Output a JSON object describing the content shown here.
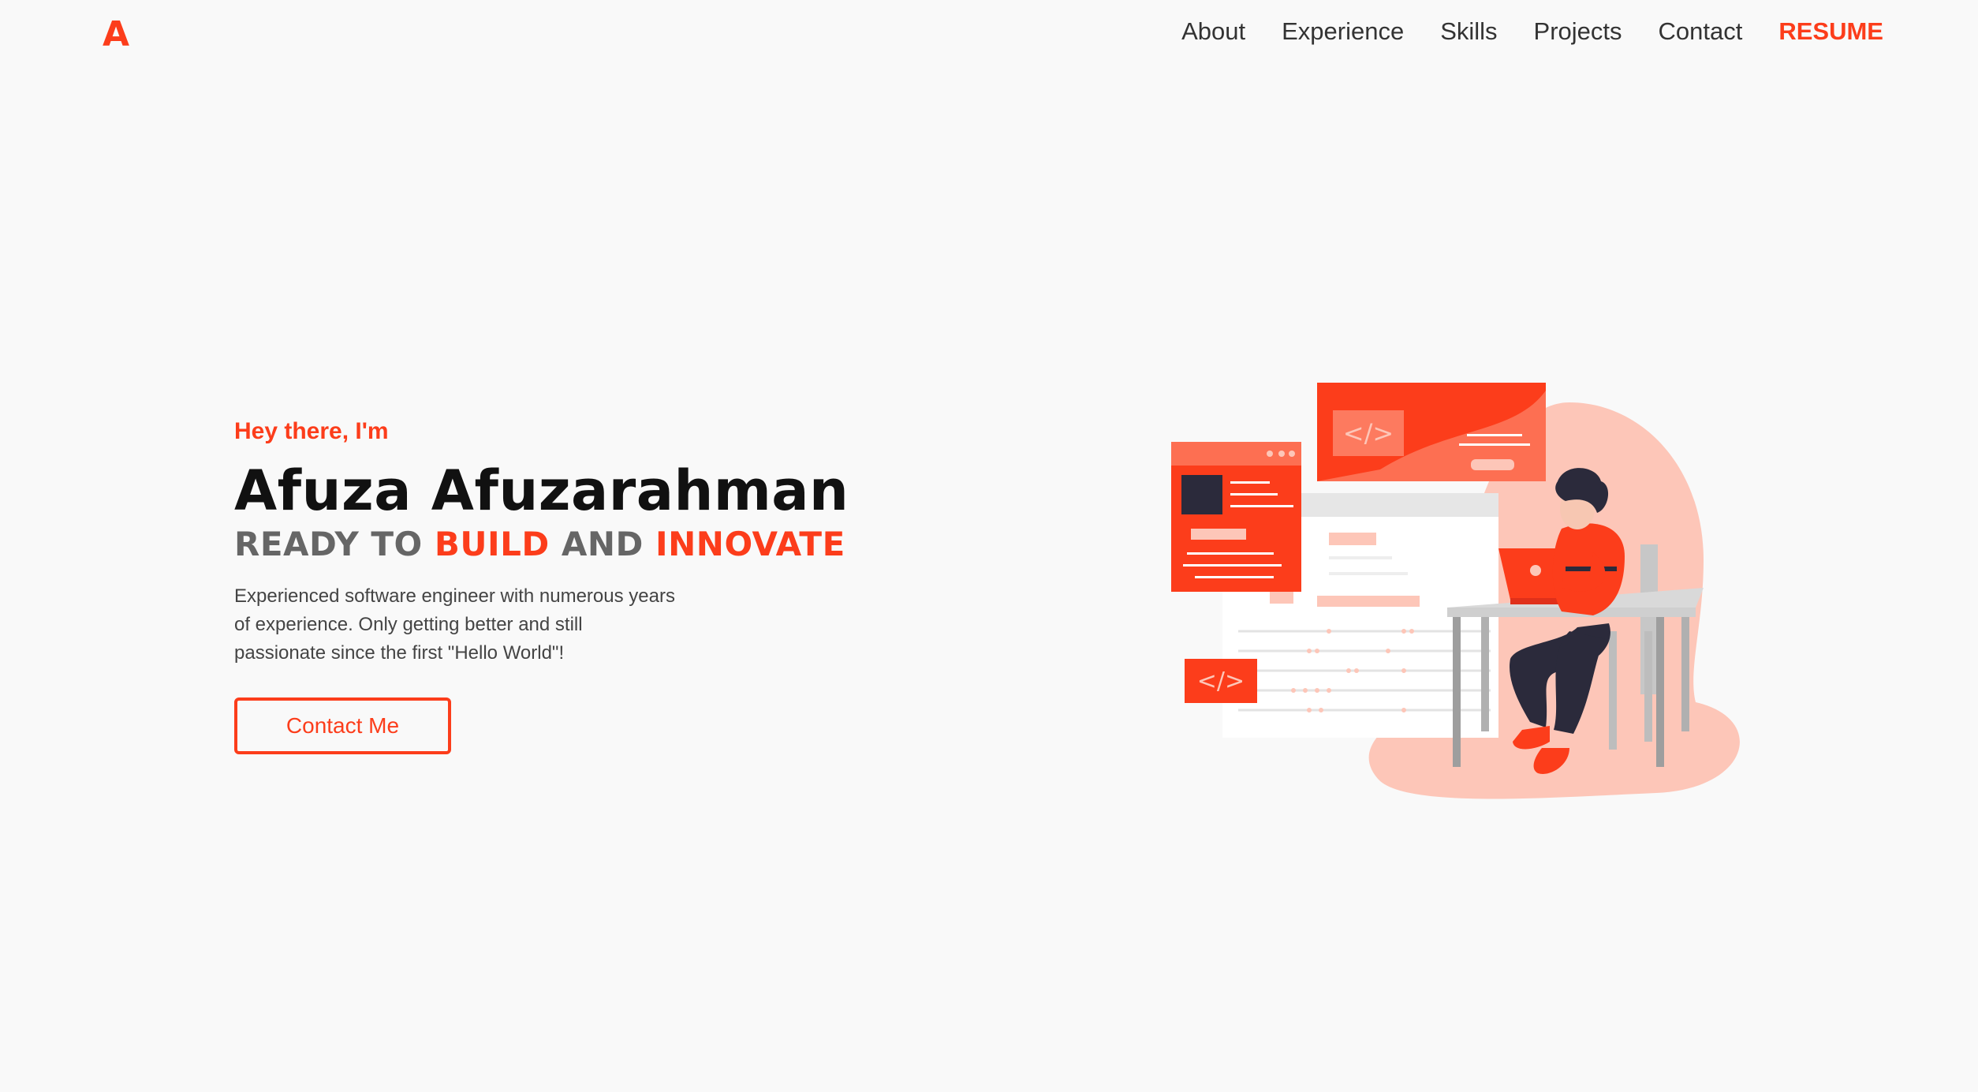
{
  "brand": {
    "logo": "A"
  },
  "nav": {
    "items": [
      "About",
      "Experience",
      "Skills",
      "Projects",
      "Contact"
    ],
    "resume": "RESUME"
  },
  "hero": {
    "greeting": "Hey there, I'm",
    "name": "Afuza Afuzarahman",
    "tagline_1": "READY TO",
    "tagline_2": "BUILD",
    "tagline_3": "AND",
    "tagline_4": "INNOVATE",
    "description": "Experienced software engineer with numerous years of experience. Only getting better and still passionate since the first \"Hello World\"!",
    "cta": "Contact Me"
  },
  "colors": {
    "accent": "#fc3d1b",
    "background": "#f9f9f9",
    "text": "#111111"
  },
  "illustration": {
    "icon": "developer-at-desk-illustration"
  }
}
